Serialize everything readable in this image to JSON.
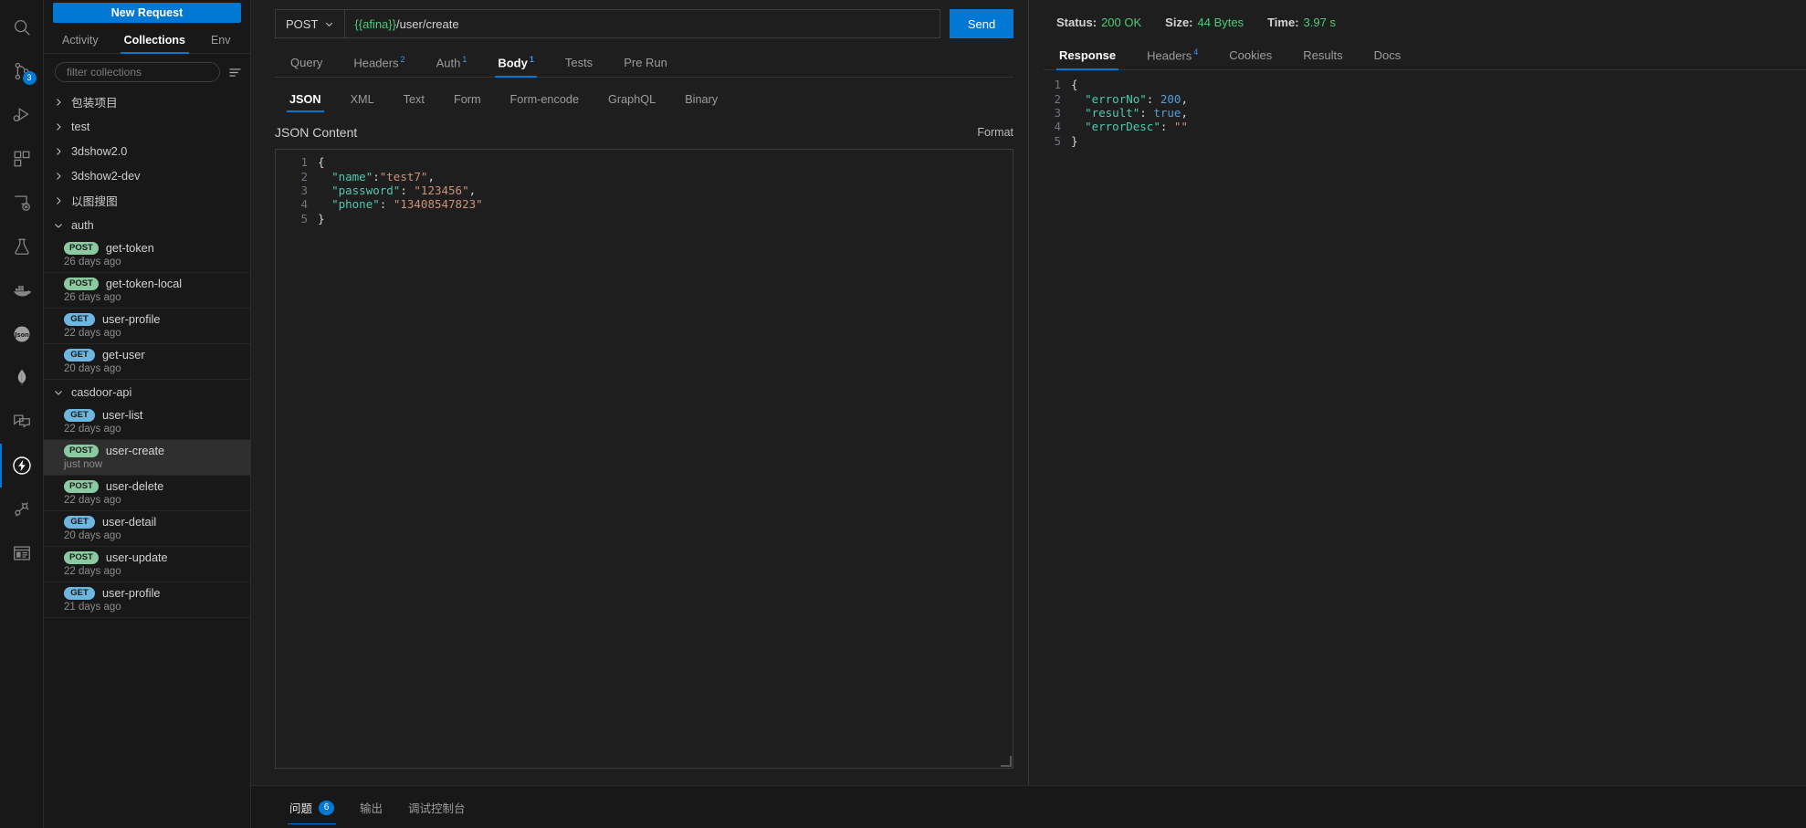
{
  "activitybar": {
    "items": [
      {
        "name": "search-icon",
        "badge": ""
      },
      {
        "name": "source-control-icon",
        "badge": "3"
      },
      {
        "name": "run-and-debug-icon",
        "badge": ""
      },
      {
        "name": "extensions-icon",
        "badge": ""
      },
      {
        "name": "remote-explorer-icon",
        "badge": ""
      },
      {
        "name": "testing-icon",
        "badge": ""
      },
      {
        "name": "docker-icon",
        "badge": ""
      },
      {
        "name": "json-icon",
        "badge": ""
      },
      {
        "name": "mongodb-icon",
        "badge": ""
      },
      {
        "name": "chat-icon",
        "badge": ""
      },
      {
        "name": "thunder-client-icon",
        "badge": ""
      },
      {
        "name": "database-client-icon",
        "badge": ""
      },
      {
        "name": "browser-preview-icon",
        "badge": ""
      }
    ]
  },
  "sidebar": {
    "new_request_label": "New Request",
    "tabs": [
      {
        "label": "Activity",
        "active": false
      },
      {
        "label": "Collections",
        "active": true
      },
      {
        "label": "Env",
        "active": false
      }
    ],
    "filter_placeholder": "filter collections",
    "filter_value": "",
    "menu_icon": "filter-menu-icon",
    "tree": [
      {
        "type": "folder",
        "label": "包装项目",
        "expanded": false
      },
      {
        "type": "folder",
        "label": "test",
        "expanded": false
      },
      {
        "type": "folder",
        "label": "3dshow2.0",
        "expanded": false
      },
      {
        "type": "folder",
        "label": "3dshow2-dev",
        "expanded": false
      },
      {
        "type": "folder",
        "label": "以图搜图",
        "expanded": false
      },
      {
        "type": "folder",
        "label": "auth",
        "expanded": true
      },
      {
        "type": "request",
        "method": "POST",
        "label": "get-token",
        "time": "26 days ago",
        "selected": false
      },
      {
        "type": "request",
        "method": "POST",
        "label": "get-token-local",
        "time": "26 days ago",
        "selected": false
      },
      {
        "type": "request",
        "method": "GET",
        "label": "user-profile",
        "time": "22 days ago",
        "selected": false
      },
      {
        "type": "request",
        "method": "GET",
        "label": "get-user",
        "time": "20 days ago",
        "selected": false
      },
      {
        "type": "folder",
        "label": "casdoor-api",
        "expanded": true
      },
      {
        "type": "request",
        "method": "GET",
        "label": "user-list",
        "time": "22 days ago",
        "selected": false
      },
      {
        "type": "request",
        "method": "POST",
        "label": "user-create",
        "time": "just now",
        "selected": true
      },
      {
        "type": "request",
        "method": "POST",
        "label": "user-delete",
        "time": "22 days ago",
        "selected": false
      },
      {
        "type": "request",
        "method": "GET",
        "label": "user-detail",
        "time": "20 days ago",
        "selected": false
      },
      {
        "type": "request",
        "method": "POST",
        "label": "user-update",
        "time": "22 days ago",
        "selected": false
      },
      {
        "type": "request",
        "method": "GET",
        "label": "user-profile",
        "time": "21 days ago",
        "selected": false
      }
    ]
  },
  "request": {
    "method": "POST",
    "url_variable": "{{afina}}",
    "url_path": "/user/create",
    "send_label": "Send",
    "tabs": [
      {
        "label": "Query",
        "badge": "",
        "active": false
      },
      {
        "label": "Headers",
        "badge": "2",
        "active": false
      },
      {
        "label": "Auth",
        "badge": "1",
        "active": false
      },
      {
        "label": "Body",
        "badge": "1",
        "active": true
      },
      {
        "label": "Tests",
        "badge": "",
        "active": false
      },
      {
        "label": "Pre Run",
        "badge": "",
        "active": false
      }
    ],
    "body_tabs": [
      {
        "label": "JSON",
        "active": true
      },
      {
        "label": "XML",
        "active": false
      },
      {
        "label": "Text",
        "active": false
      },
      {
        "label": "Form",
        "active": false
      },
      {
        "label": "Form-encode",
        "active": false
      },
      {
        "label": "GraphQL",
        "active": false
      },
      {
        "label": "Binary",
        "active": false
      }
    ],
    "json_content_label": "JSON Content",
    "format_label": "Format",
    "body_lines": [
      {
        "n": "1",
        "tokens": [
          {
            "t": "punct",
            "v": "{"
          }
        ]
      },
      {
        "n": "2",
        "tokens": [
          {
            "t": "punct",
            "v": "  "
          },
          {
            "t": "key",
            "v": "\"name\""
          },
          {
            "t": "punct",
            "v": ":"
          },
          {
            "t": "str",
            "v": "\"test7\""
          },
          {
            "t": "punct",
            "v": ","
          }
        ]
      },
      {
        "n": "3",
        "tokens": [
          {
            "t": "punct",
            "v": "  "
          },
          {
            "t": "key",
            "v": "\"password\""
          },
          {
            "t": "punct",
            "v": ": "
          },
          {
            "t": "str",
            "v": "\"123456\""
          },
          {
            "t": "punct",
            "v": ","
          }
        ]
      },
      {
        "n": "4",
        "tokens": [
          {
            "t": "punct",
            "v": "  "
          },
          {
            "t": "key",
            "v": "\"phone\""
          },
          {
            "t": "punct",
            "v": ": "
          },
          {
            "t": "str",
            "v": "\"13408547823\""
          }
        ]
      },
      {
        "n": "5",
        "tokens": [
          {
            "t": "punct",
            "v": "}"
          }
        ]
      }
    ]
  },
  "response": {
    "status_label": "Status:",
    "status_value": "200 OK",
    "size_label": "Size:",
    "size_value": "44 Bytes",
    "time_label": "Time:",
    "time_value": "3.97 s",
    "tabs": [
      {
        "label": "Response",
        "badge": "",
        "active": true
      },
      {
        "label": "Headers",
        "badge": "4",
        "active": false
      },
      {
        "label": "Cookies",
        "badge": "",
        "active": false
      },
      {
        "label": "Results",
        "badge": "",
        "active": false
      },
      {
        "label": "Docs",
        "badge": "",
        "active": false
      }
    ],
    "body_lines": [
      {
        "n": "1",
        "tokens": [
          {
            "t": "punct",
            "v": "{"
          }
        ]
      },
      {
        "n": "2",
        "tokens": [
          {
            "t": "punct",
            "v": "  "
          },
          {
            "t": "key",
            "v": "\"errorNo\""
          },
          {
            "t": "punct",
            "v": ": "
          },
          {
            "t": "num",
            "v": "200"
          },
          {
            "t": "punct",
            "v": ","
          }
        ]
      },
      {
        "n": "3",
        "tokens": [
          {
            "t": "punct",
            "v": "  "
          },
          {
            "t": "key",
            "v": "\"result\""
          },
          {
            "t": "punct",
            "v": ": "
          },
          {
            "t": "bool",
            "v": "true"
          },
          {
            "t": "punct",
            "v": ","
          }
        ]
      },
      {
        "n": "4",
        "tokens": [
          {
            "t": "punct",
            "v": "  "
          },
          {
            "t": "key",
            "v": "\"errorDesc\""
          },
          {
            "t": "punct",
            "v": ": "
          },
          {
            "t": "str",
            "v": "\"\""
          }
        ]
      },
      {
        "n": "5",
        "tokens": [
          {
            "t": "punct",
            "v": "}"
          }
        ]
      }
    ]
  },
  "bottom_panel": {
    "tabs": [
      {
        "label": "问题",
        "badge": "6",
        "active": true
      },
      {
        "label": "输出",
        "badge": "",
        "active": false
      },
      {
        "label": "调试控制台",
        "badge": "",
        "active": false
      }
    ]
  },
  "colors": {
    "accent": "#0078d4",
    "success": "#4ec97a",
    "post_badge": "#8bc9a0",
    "get_badge": "#6cb6e0",
    "bg": "#1e1e1e",
    "sidebar_bg": "#181818"
  }
}
